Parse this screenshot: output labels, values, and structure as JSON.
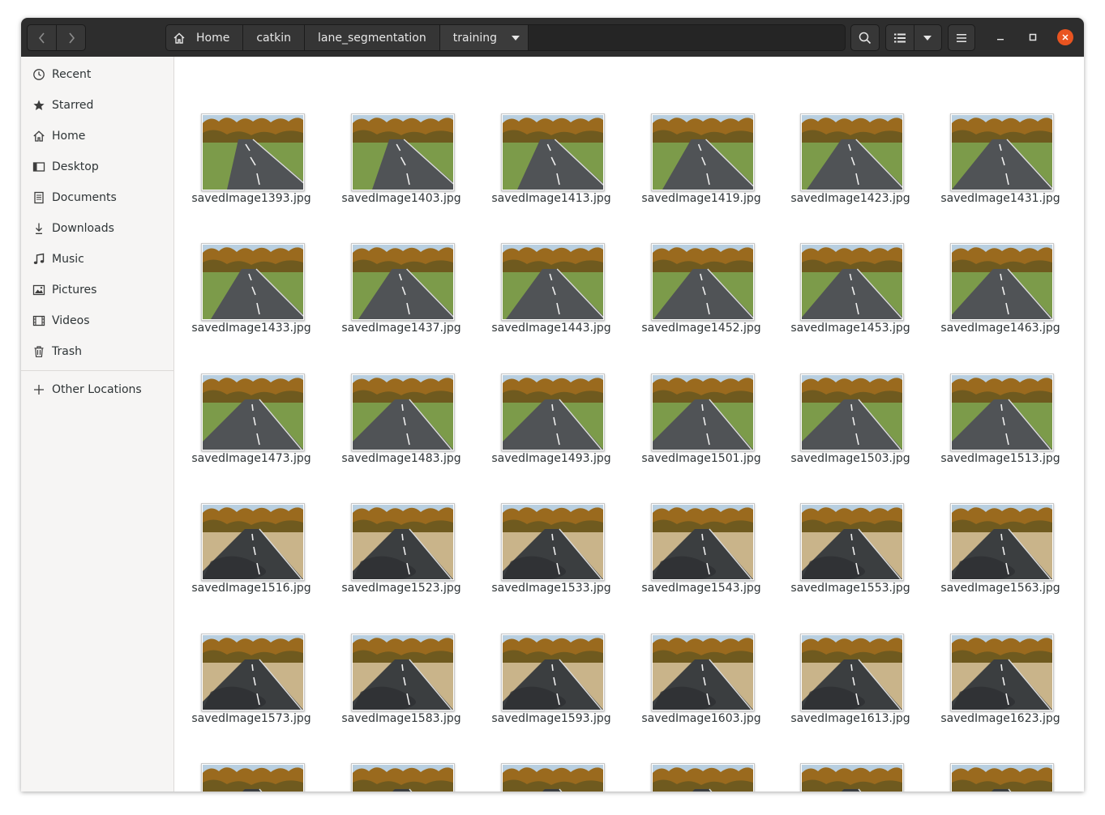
{
  "header": {
    "back_icon": "chevron-left-icon",
    "forward_icon": "chevron-right-icon",
    "breadcrumbs": [
      "Home",
      "catkin",
      "lane_segmentation",
      "training"
    ],
    "icons": {
      "search": "search-icon",
      "list_view": "list-view-icon",
      "view_options": "chevron-down-icon",
      "menu": "hamburger-menu-icon",
      "minimize": "minimize-icon",
      "maximize": "maximize-icon",
      "close": "close-icon"
    },
    "colors": {
      "headerbar": "#2d2d2d",
      "close_button": "#e95420"
    }
  },
  "sidebar": {
    "items": [
      {
        "label": "Recent",
        "icon": "clock-icon"
      },
      {
        "label": "Starred",
        "icon": "star-icon"
      },
      {
        "label": "Home",
        "icon": "home-icon"
      },
      {
        "label": "Desktop",
        "icon": "desktop-icon"
      },
      {
        "label": "Documents",
        "icon": "document-icon"
      },
      {
        "label": "Downloads",
        "icon": "download-icon"
      },
      {
        "label": "Music",
        "icon": "music-icon"
      },
      {
        "label": "Pictures",
        "icon": "picture-icon"
      },
      {
        "label": "Videos",
        "icon": "video-icon"
      },
      {
        "label": "Trash",
        "icon": "trash-icon"
      }
    ],
    "other_locations": {
      "label": "Other Locations",
      "icon": "plus-icon"
    }
  },
  "files": [
    "savedImage1393.jpg",
    "savedImage1403.jpg",
    "savedImage1413.jpg",
    "savedImage1419.jpg",
    "savedImage1423.jpg",
    "savedImage1431.jpg",
    "savedImage1433.jpg",
    "savedImage1437.jpg",
    "savedImage1443.jpg",
    "savedImage1452.jpg",
    "savedImage1453.jpg",
    "savedImage1463.jpg",
    "savedImage1473.jpg",
    "savedImage1483.jpg",
    "savedImage1493.jpg",
    "savedImage1501.jpg",
    "savedImage1503.jpg",
    "savedImage1513.jpg",
    "savedImage1516.jpg",
    "savedImage1523.jpg",
    "savedImage1533.jpg",
    "savedImage1543.jpg",
    "savedImage1553.jpg",
    "savedImage1563.jpg",
    "savedImage1573.jpg",
    "savedImage1583.jpg",
    "savedImage1593.jpg",
    "savedImage1603.jpg",
    "savedImage1613.jpg",
    "savedImage1623.jpg",
    "",
    "",
    "",
    "",
    "",
    ""
  ]
}
